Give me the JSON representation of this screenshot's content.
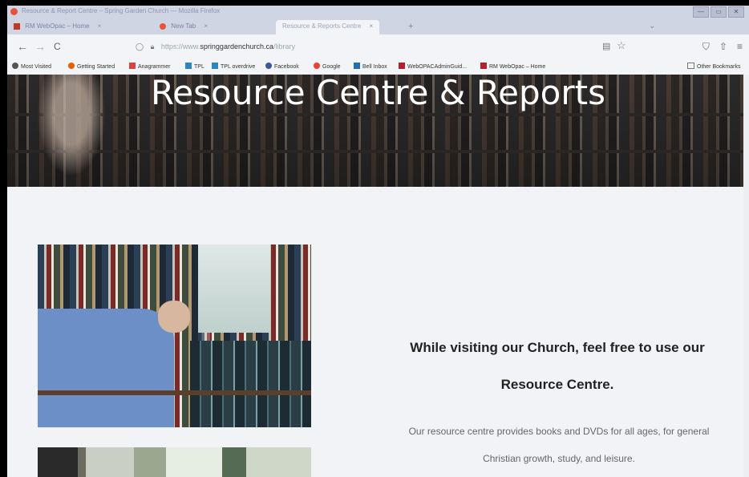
{
  "window": {
    "title": "Resource & Report Centre – Spring Garden Church — Mozilla Firefox",
    "buttons": [
      "—",
      "▭",
      "✕"
    ]
  },
  "tabs": [
    {
      "label": "RM WebOpac – Home",
      "close": "×"
    },
    {
      "label": "New Tab",
      "close": "×"
    },
    {
      "label": "Resource & Reports Centre",
      "close": "×"
    }
  ],
  "new_tab": "+",
  "tab_overflow": "⌄",
  "nav": {
    "back": "←",
    "forward": "→",
    "reload": "C",
    "url_prefix": "https://www.",
    "url_host": "springgardenchurch.ca",
    "url_path": "/library",
    "reader": "▤",
    "bookmark_star": "☆",
    "pocket": "⛉",
    "share": "⇧",
    "menu": "≡"
  },
  "bookmarks": [
    {
      "label": "Most Visited",
      "icon": "gear-icon",
      "color": "#555555"
    },
    {
      "label": "Getting Started",
      "icon": "firefox-icon",
      "color": "#e66000"
    },
    {
      "label": "Anagrammer",
      "icon": "a-icon",
      "color": "#d64541"
    },
    {
      "label": "TPL",
      "icon": "tpl-icon",
      "color": "#2e86c1"
    },
    {
      "label": "TPL overdrive",
      "icon": "link-icon",
      "color": "#2e86c1"
    },
    {
      "label": "Facebook",
      "icon": "globe-icon",
      "color": "#3b5998"
    },
    {
      "label": "Google",
      "icon": "google-icon",
      "color": "#ea4335"
    },
    {
      "label": "Bell Inbox",
      "icon": "mail-icon",
      "color": "#1f6fb2"
    },
    {
      "label": "WebOPACAdminGuid...",
      "icon": "rm-icon",
      "color": "#b3202e"
    },
    {
      "label": "RM WebOpac – Home",
      "icon": "rm-icon",
      "color": "#b3202e"
    }
  ],
  "other_bookmarks": "Other Bookmarks",
  "hero": {
    "title": "Resource Centre & Reports"
  },
  "content": {
    "tagline": "While visiting our Church, feel free to use our Resource Centre.",
    "body": "Our resource centre provides books and DVDs for all ages, for general Christian growth, study, and leisure."
  },
  "colors": {
    "accent_red": "#e8543a",
    "hero_text": "#ffffff",
    "tagline_text": "#222222",
    "body_text": "#666666"
  }
}
